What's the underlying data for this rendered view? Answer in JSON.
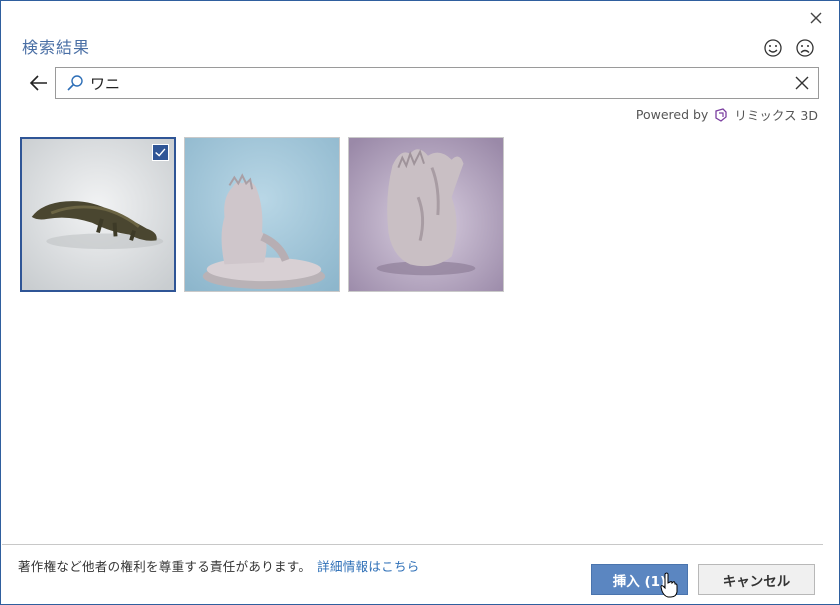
{
  "dialog": {
    "title": "検索結果",
    "feedback": {
      "positive_icon": "smiley-icon",
      "negative_icon": "frown-icon"
    }
  },
  "search": {
    "value": "ワニ",
    "placeholder": ""
  },
  "attribution": {
    "powered_by": "Powered by",
    "provider": "リミックス 3D"
  },
  "results": [
    {
      "name": "crocodile-model",
      "selected": true
    },
    {
      "name": "crocodile-sculpture-blue",
      "selected": false
    },
    {
      "name": "crocodile-sculpture-purple",
      "selected": false
    }
  ],
  "footer": {
    "note": "著作権など他者の権利を尊重する責任があります。",
    "link": "詳細情報はこちら",
    "insert_label": "挿入 (1)",
    "cancel_label": "キャンセル"
  },
  "colors": {
    "accent": "#2f5596",
    "title": "#4a6fa5",
    "link": "#2e6fb7",
    "insert_button": "#5b86c1"
  }
}
